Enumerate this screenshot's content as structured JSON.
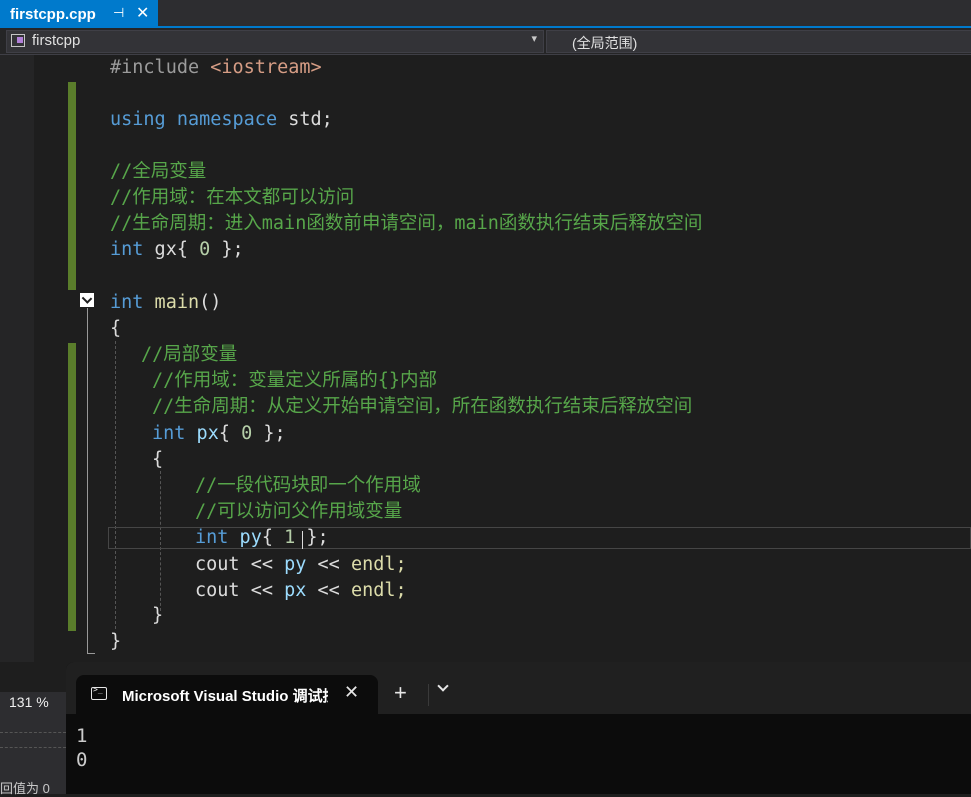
{
  "tab": {
    "title": "firstcpp.cpp",
    "pin_glyph": "⊣",
    "close_glyph": "✕"
  },
  "navbar": {
    "project": "firstcpp",
    "scope": "(全局范围)",
    "arrow": "▾"
  },
  "code": {
    "l1": {
      "pre": "#include ",
      "str": "<iostream>"
    },
    "l2": {
      "kw1": "using",
      "kw2": " namespace",
      "rest": " std;"
    },
    "l3": "//全局变量",
    "l4": "//作用域：在本文都可以访问",
    "l5": "//生命周期：进入main函数前申请空间，main函数执行结束后释放空间",
    "l6": {
      "kw": "int",
      "name": " gx",
      "b1": "{ ",
      "num": "0",
      "b2": " };"
    },
    "l7": {
      "kw": "int",
      "fn": " main",
      "rest": "()"
    },
    "l8": "{",
    "l9": "//局部变量",
    "l10": "//作用域：变量定义所属的{}内部",
    "l11": "//生命周期：从定义开始申请空间，所在函数执行结束后释放空间",
    "l12": {
      "kw": "int",
      "var": " px",
      "b1": "{ ",
      "num": "0",
      "b2": " };"
    },
    "l13": "{",
    "l14": "//一段代码块即一个作用域",
    "l15": "//可以访问父作用域变量",
    "l16": {
      "kw": "int",
      "var": " py",
      "b1": "{ ",
      "num": "1",
      "b2": " };"
    },
    "l17": {
      "a": "cout ",
      "op1": "<<",
      "var": " py",
      "op2": " <<",
      "b": " endl;"
    },
    "l18": {
      "a": "cout ",
      "op1": "<<",
      "var": " px",
      "op2": " <<",
      "b": " endl;"
    },
    "l19": "}",
    "l20": "}"
  },
  "zoom": {
    "value": "131 %"
  },
  "bottom_text": "回值为 0",
  "terminal": {
    "title": "Microsoft Visual Studio 调试控制台",
    "close": "✕",
    "add": "+",
    "output": [
      "1",
      "0"
    ]
  }
}
